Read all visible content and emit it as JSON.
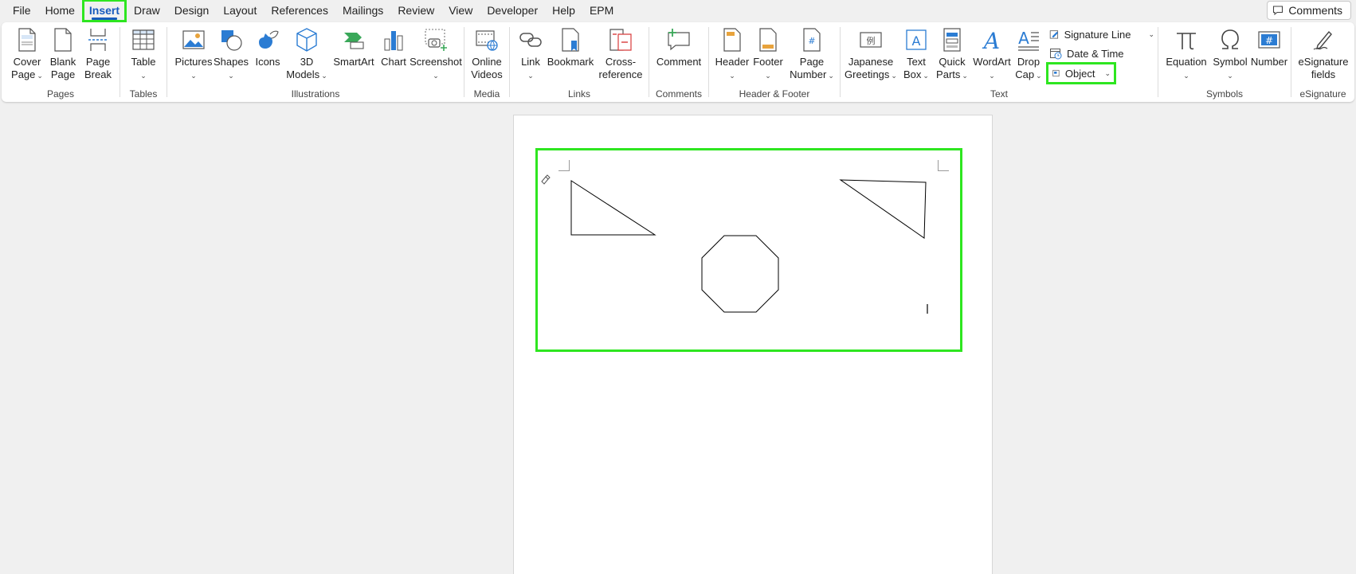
{
  "menu": {
    "items": [
      "File",
      "Home",
      "Insert",
      "Draw",
      "Design",
      "Layout",
      "References",
      "Mailings",
      "Review",
      "View",
      "Developer",
      "Help",
      "EPM"
    ],
    "active": "Insert",
    "comments_label": "Comments"
  },
  "ribbon": {
    "pages": {
      "label": "Pages",
      "cover_page": [
        "Cover",
        "Page"
      ],
      "blank_page": [
        "Blank",
        "Page"
      ],
      "page_break": [
        "Page",
        "Break"
      ]
    },
    "tables": {
      "label": "Tables",
      "table": "Table"
    },
    "illustrations": {
      "label": "Illustrations",
      "pictures": "Pictures",
      "shapes": "Shapes",
      "icons": "Icons",
      "models_3d": [
        "3D",
        "Models"
      ],
      "smartart": "SmartArt",
      "chart": "Chart",
      "screenshot": "Screenshot"
    },
    "media": {
      "label": "Media",
      "online_videos": [
        "Online",
        "Videos"
      ]
    },
    "links": {
      "label": "Links",
      "link": "Link",
      "bookmark": "Bookmark",
      "cross_reference": [
        "Cross-",
        "reference"
      ]
    },
    "comments": {
      "label": "Comments",
      "comment": "Comment"
    },
    "header_footer": {
      "label": "Header & Footer",
      "header": "Header",
      "footer": "Footer",
      "page_number": [
        "Page",
        "Number"
      ]
    },
    "text": {
      "label": "Text",
      "japanese_greetings": [
        "Japanese",
        "Greetings"
      ],
      "text_box": [
        "Text",
        "Box"
      ],
      "quick_parts": [
        "Quick",
        "Parts"
      ],
      "wordart": "WordArt",
      "drop_cap": [
        "Drop",
        "Cap"
      ],
      "signature_line": "Signature Line",
      "date_time": "Date & Time",
      "object": "Object"
    },
    "symbols": {
      "label": "Symbols",
      "equation": "Equation",
      "symbol": "Symbol",
      "number": "Number"
    },
    "esignature": {
      "label": "eSignature",
      "fields": [
        "eSignature",
        "fields"
      ]
    }
  },
  "colors": {
    "accent": "#185abd",
    "highlight": "#2ee620",
    "canvas": "#f0f0f0",
    "icon_blue": "#2b7cd3",
    "icon_orange": "#e8a33c",
    "icon_red": "#d83b3b",
    "icon_green": "#3aa859"
  }
}
